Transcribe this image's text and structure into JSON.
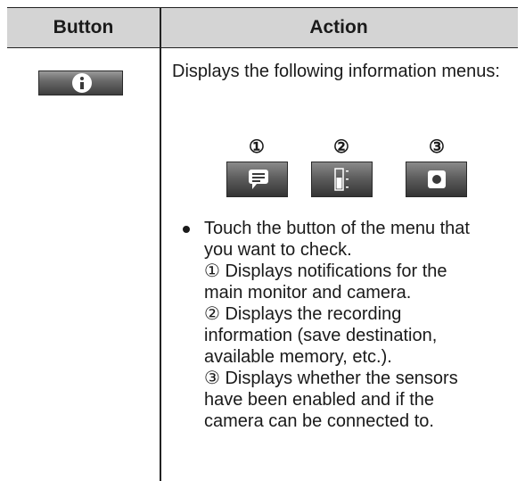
{
  "table": {
    "header": {
      "button": "Button",
      "action": "Action"
    },
    "row": {
      "button_icon": "info-icon",
      "intro": "Displays the following information menus:",
      "menu_numbers": [
        "①",
        "②",
        "③"
      ],
      "menu_icons": [
        "notification-icon",
        "recording-icon",
        "sensor-icon"
      ],
      "lines": [
        "Touch the button of the menu that",
        "you want to check.",
        "① Displays notifications for the",
        "main monitor and camera.",
        "② Displays the recording",
        "information (save destination,",
        "available memory, etc.).",
        "③ Displays whether the sensors",
        "have been enabled and if the",
        "camera can be connected to."
      ]
    }
  }
}
